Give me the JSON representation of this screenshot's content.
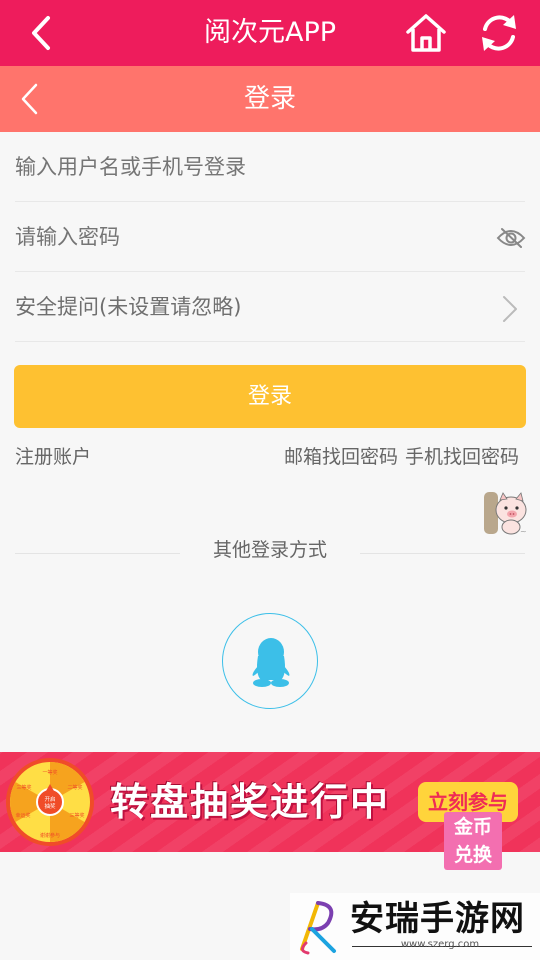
{
  "app_bar": {
    "title": "阅次元APP",
    "back_icon": "chevron-left-icon",
    "home_icon": "home-icon",
    "refresh_icon": "refresh-icon",
    "background": "#ee1c5c"
  },
  "sub_bar": {
    "title": "登录",
    "back_icon": "chevron-left-icon",
    "background": "#ff746c"
  },
  "form": {
    "username_placeholder": "输入用户名或手机号登录",
    "password_placeholder": "请输入密码",
    "password_toggle_icon": "eye-off-icon",
    "security_question_label": "安全提问(未设置请忽略)",
    "security_chevron_icon": "chevron-right-icon",
    "login_button": "登录",
    "login_button_color": "#fec131"
  },
  "links": {
    "register": "注册账户",
    "email_recover": "邮箱找回密码",
    "phone_recover": "手机找回密码"
  },
  "mascot_icon": "pig-mascot-icon",
  "other_login": {
    "title": "其他登录方式",
    "qq_icon": "qq-penguin-icon",
    "accent": "#3cbfe8"
  },
  "banner": {
    "wheel_icon": "prize-wheel-icon",
    "wheel_center": "开启抽奖",
    "headline": "转盘抽奖进行中",
    "cta": "立刻参与",
    "badge_line1": "金币",
    "badge_line2": "兑换"
  },
  "watermark": {
    "title": "安瑞手游网",
    "url": "www.szerg.com"
  }
}
